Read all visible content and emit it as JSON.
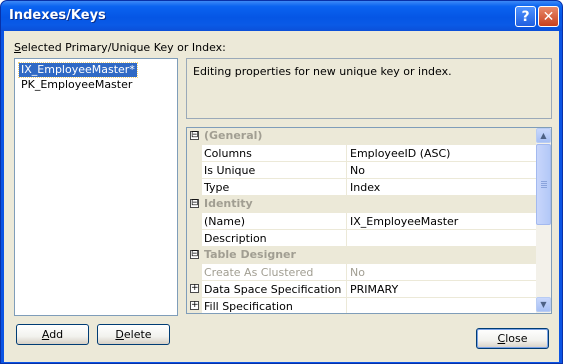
{
  "window": {
    "title": "Indexes/Keys",
    "help_button": "?",
    "close_button": "✕"
  },
  "list_label_first": "S",
  "list_label_rest": "elected Primary/Unique Key or Index:",
  "keys": [
    {
      "label": "IX_EmployeeMaster*",
      "selected": true
    },
    {
      "label": "PK_EmployeeMaster",
      "selected": false
    }
  ],
  "description": "Editing properties for new unique key or index.",
  "grid": {
    "rows": [
      {
        "kind": "category",
        "label": "(General)",
        "expander": "⊟"
      },
      {
        "kind": "prop",
        "name": "Columns",
        "value": "EmployeeID (ASC)"
      },
      {
        "kind": "prop",
        "name": "Is Unique",
        "value": "No"
      },
      {
        "kind": "prop",
        "name": "Type",
        "value": "Index"
      },
      {
        "kind": "category",
        "label": "Identity",
        "expander": "⊟"
      },
      {
        "kind": "prop",
        "name": "(Name)",
        "value": "IX_EmployeeMaster"
      },
      {
        "kind": "prop",
        "name": "Description",
        "value": ""
      },
      {
        "kind": "category",
        "label": "Table Designer",
        "expander": "⊟"
      },
      {
        "kind": "prop",
        "name": "Create As Clustered",
        "value": "No",
        "disabled": true
      },
      {
        "kind": "prop",
        "name": "Data Space Specification",
        "value": "PRIMARY",
        "expander": "+"
      },
      {
        "kind": "prop",
        "name": "Fill Specification",
        "value": "",
        "expander": "+"
      }
    ]
  },
  "buttons": {
    "add_first": "A",
    "add_rest": "dd",
    "delete_first": "D",
    "delete_rest": "elete",
    "close_first": "C",
    "close_rest": "lose"
  },
  "scrollbar": {
    "up_arrow": "▲",
    "down_arrow": "▼"
  }
}
